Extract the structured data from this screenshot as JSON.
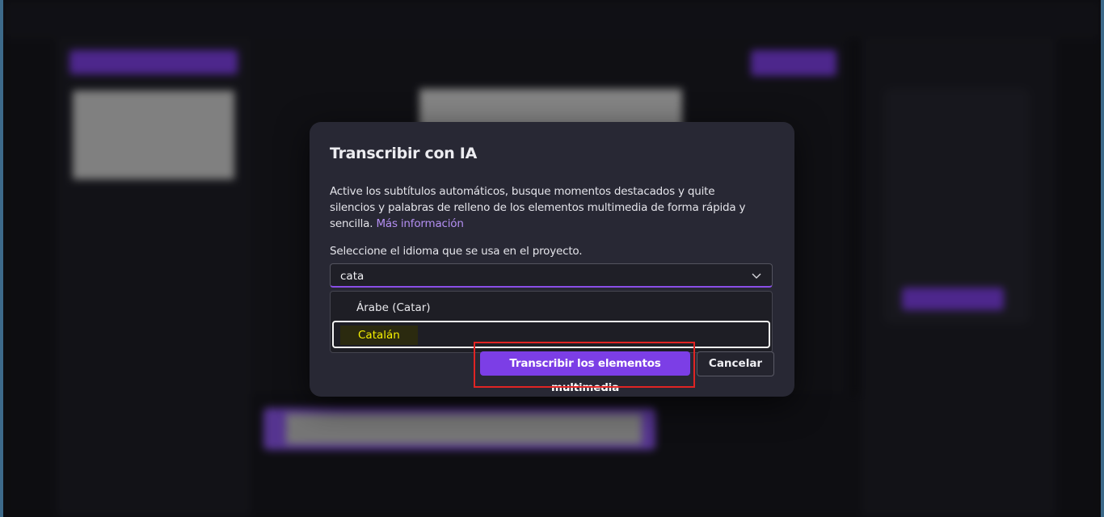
{
  "dialog": {
    "title": "Transcribir con IA",
    "description": "Active los subtítulos automáticos, busque momentos destacados y quite silencios y palabras de relleno de los elementos multimedia de forma rápida y sencilla.",
    "more_info_link": "Más información",
    "language_label": "Seleccione el idioma que se usa en el proyecto.",
    "language_input_value": "cata",
    "dropdown_options": [
      {
        "label": "Árabe (Catar)"
      },
      {
        "label": "Catalán",
        "focused": true,
        "highlight_color": "#f7f200"
      }
    ],
    "transcribe_button": "Transcribir los elementos multimedia",
    "cancel_button": "Cancelar",
    "chevron_icon": "chevron-down-icon"
  },
  "colors": {
    "accent": "#7c3ee6",
    "link": "#b48ff2",
    "annotation": "#e02424",
    "dialog_bg": "#282834"
  }
}
